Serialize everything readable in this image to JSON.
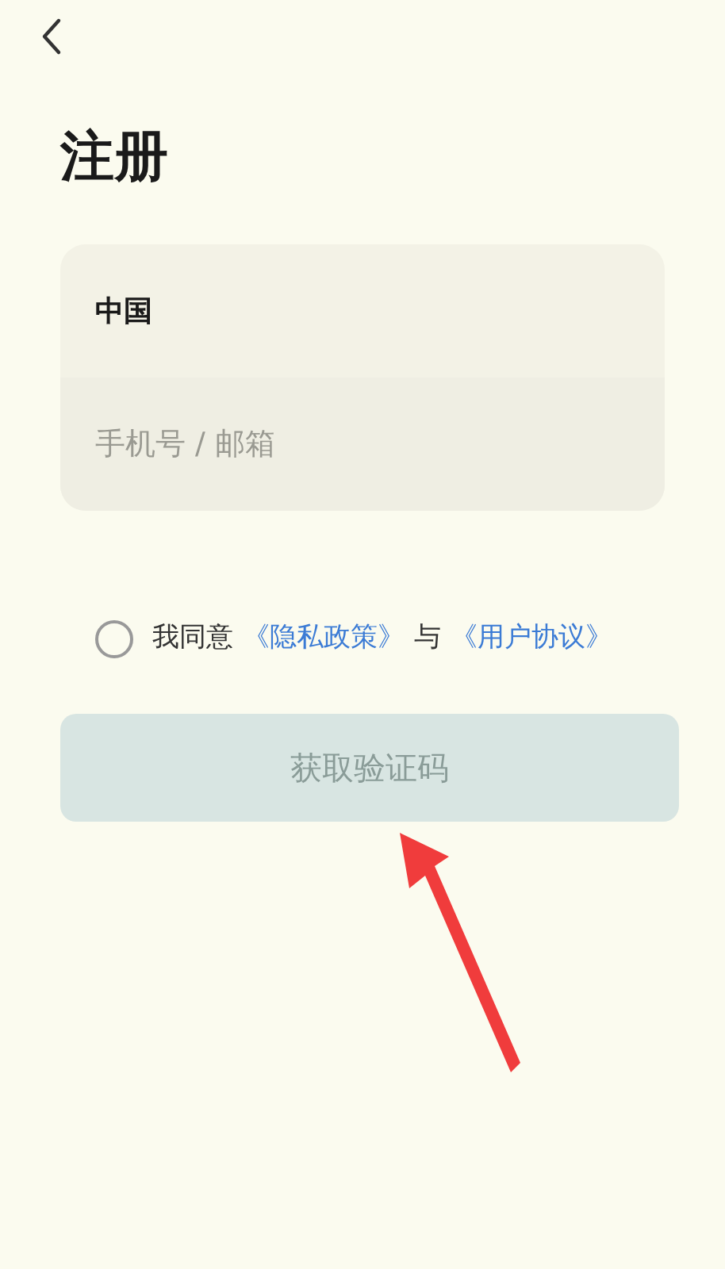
{
  "title": "注册",
  "form": {
    "region": "中国",
    "phone": {
      "placeholder": "手机号 / 邮箱"
    }
  },
  "agreement": {
    "checked": false,
    "prefix": "我同意",
    "policy_link": "《隐私政策》",
    "conjunction": "与",
    "terms_link": "《用户协议》"
  },
  "submit": {
    "label": "获取验证码",
    "disabled": true
  },
  "annotation": {
    "kind": "arrow"
  }
}
